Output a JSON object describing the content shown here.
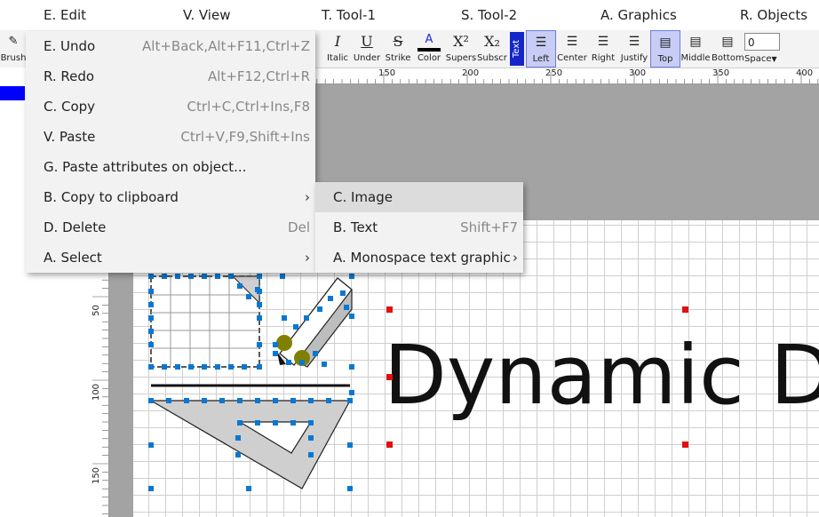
{
  "menubar": {
    "edit": "E. Edit",
    "view": "V. View",
    "tool1": "T. Tool-1",
    "tool2": "S. Tool-2",
    "graphics": "A. Graphics",
    "objects": "R. Objects"
  },
  "toolbar": {
    "brush": "Brush",
    "italic": "Italic",
    "under": "Under",
    "strike": "Strike",
    "color": "Color",
    "supers": "Supers",
    "subscr": "Subscr",
    "text_badge": "Text",
    "left": "Left",
    "center": "Center",
    "right": "Right",
    "justify": "Justify",
    "top": "Top",
    "middle": "Middle",
    "bottom": "Bottom",
    "space_value": "0",
    "space_label": "Space",
    "italic_glyph": "I",
    "under_glyph": "U",
    "strike_glyph": "S",
    "color_glyph": "A",
    "supers_glyph": "X²",
    "subscr_glyph": "X₂"
  },
  "ruler": {
    "h_ticks": [
      "150",
      "200",
      "250",
      "300",
      "350",
      "400"
    ],
    "v_ticks": [
      "50",
      "100",
      "150"
    ]
  },
  "edit_menu": [
    {
      "label": "E. Undo",
      "shortcut": "Alt+Back,Alt+F11,Ctrl+Z"
    },
    {
      "label": "R. Redo",
      "shortcut": "Alt+F12,Ctrl+R"
    },
    {
      "label": "C. Copy",
      "shortcut": "Ctrl+C,Ctrl+Ins,F8"
    },
    {
      "label": "V. Paste",
      "shortcut": "Ctrl+V,F9,Shift+Ins"
    },
    {
      "label": "G. Paste attributes on object...",
      "shortcut": ""
    },
    {
      "label": "B. Copy to clipboard",
      "shortcut": ""
    },
    {
      "label": "D. Delete",
      "shortcut": "Del"
    },
    {
      "label": "A. Select",
      "shortcut": ""
    }
  ],
  "submenu": [
    {
      "label": "C. Image",
      "shortcut": ""
    },
    {
      "label": "B. Text",
      "shortcut": "Shift+F7"
    },
    {
      "label": "A. Monospace text graphic",
      "shortcut": ""
    }
  ],
  "canvas": {
    "text": "Dynamic D"
  },
  "colors": {
    "selection_handle": "#0a78d2",
    "text_handle": "#e01010",
    "accent_blue": "#1426c8"
  }
}
